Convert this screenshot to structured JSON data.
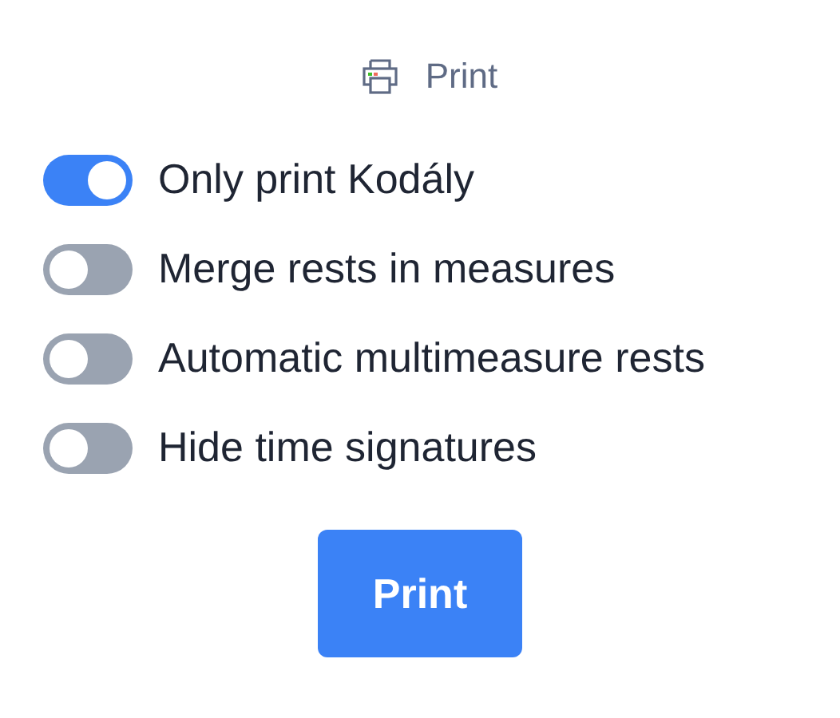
{
  "header": {
    "title": "Print"
  },
  "options": [
    {
      "label": "Only print Kodály",
      "on": true
    },
    {
      "label": "Merge rests in measures",
      "on": false
    },
    {
      "label": "Automatic multimeasure rests",
      "on": false
    },
    {
      "label": "Hide time signatures",
      "on": false
    }
  ],
  "button": {
    "label": "Print"
  }
}
